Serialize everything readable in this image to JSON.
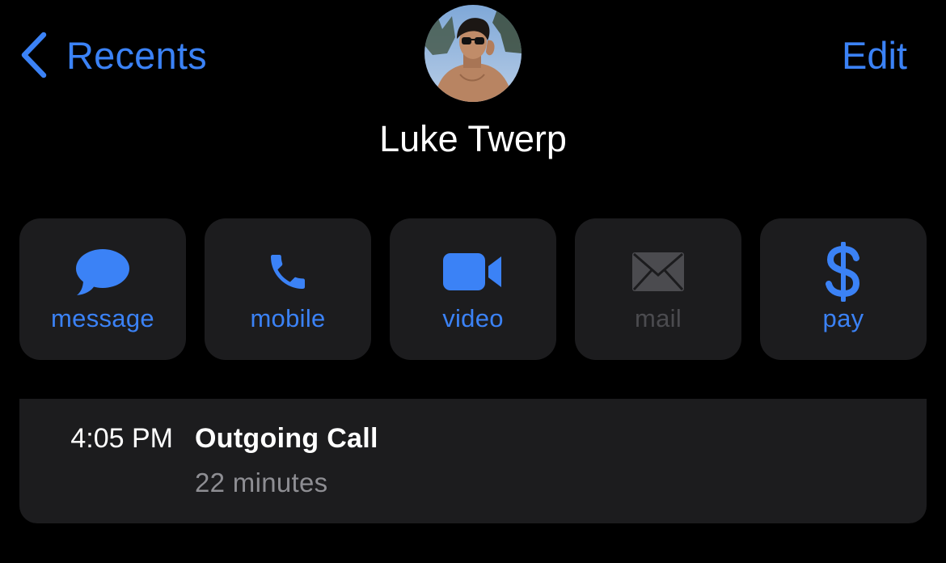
{
  "nav": {
    "back_label": "Recents",
    "edit_label": "Edit",
    "back_icon": "chevron-left-icon"
  },
  "contact": {
    "name": "Luke Twerp",
    "avatar": "contact-photo"
  },
  "actions": [
    {
      "label": "message",
      "icon": "message-bubble-icon",
      "enabled": true
    },
    {
      "label": "mobile",
      "icon": "phone-icon",
      "enabled": true
    },
    {
      "label": "video",
      "icon": "video-camera-icon",
      "enabled": true
    },
    {
      "label": "mail",
      "icon": "envelope-icon",
      "enabled": false
    },
    {
      "label": "pay",
      "icon": "dollar-icon",
      "enabled": true
    }
  ],
  "call_log": {
    "time": "4:05 PM",
    "type": "Outgoing Call",
    "duration": "22 minutes"
  },
  "colors": {
    "accent": "#3b82f6",
    "background": "#000000",
    "card": "#1c1c1e",
    "secondary_text": "#8e8e93",
    "disabled": "#4b4b4f"
  }
}
